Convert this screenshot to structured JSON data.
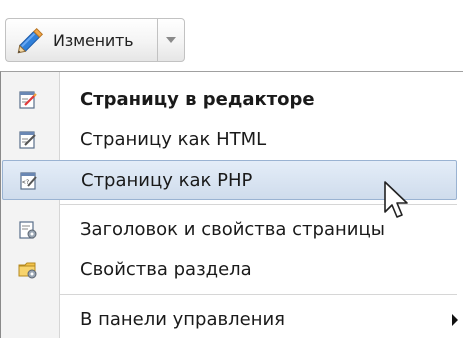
{
  "toolbar": {
    "edit_button_label": "Изменить",
    "edit_icon": "pencil-icon",
    "dropdown_icon": "chevron-down-icon"
  },
  "menu": {
    "items": [
      {
        "label": "Страницу в редакторе",
        "icon": "page-editor-icon",
        "bold": true,
        "hovered": false
      },
      {
        "label": "Страницу как HTML",
        "icon": "page-html-icon",
        "bold": false,
        "hovered": false
      },
      {
        "label": "Страницу как PHP",
        "icon": "page-php-icon",
        "bold": false,
        "hovered": true
      },
      {
        "label": "Заголовок и свойства страницы",
        "icon": "page-properties-icon",
        "bold": false,
        "hovered": false
      },
      {
        "label": "Свойства раздела",
        "icon": "folder-properties-icon",
        "bold": false,
        "hovered": false
      },
      {
        "label": "В панели управления",
        "icon": "",
        "bold": false,
        "hovered": false,
        "has_submenu": true
      }
    ]
  },
  "colors": {
    "hover_bg": "#cfdcec",
    "hover_border": "#9ab3d2",
    "pencil_blue": "#2f7fd8",
    "pencil_orange": "#f0a64a"
  }
}
